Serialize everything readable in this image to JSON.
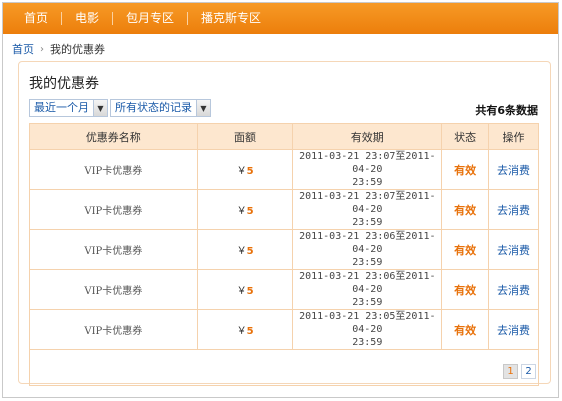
{
  "nav": {
    "items": [
      "首页",
      "电影",
      "包月专区",
      "播克斯专区"
    ]
  },
  "breadcrumb": {
    "home": "首页",
    "separator": "›",
    "current": "我的优惠券"
  },
  "panel": {
    "title": "我的优惠券",
    "filters": {
      "time": "最近一个月",
      "status": "所有状态的记录",
      "dropdown_glyph": "▼"
    },
    "count_text": "共有6条数据"
  },
  "table": {
    "headers": [
      "优惠券名称",
      "面额",
      "有效期",
      "状态",
      "操作"
    ],
    "rows": [
      {
        "name": "VIP卡优惠券",
        "yen": "￥",
        "amount": "5",
        "valid_line1": "2011-03-21 23:07至2011-04-20",
        "valid_line2": "23:59",
        "status": "有效",
        "action": "去消费"
      },
      {
        "name": "VIP卡优惠券",
        "yen": "￥",
        "amount": "5",
        "valid_line1": "2011-03-21 23:07至2011-04-20",
        "valid_line2": "23:59",
        "status": "有效",
        "action": "去消费"
      },
      {
        "name": "VIP卡优惠券",
        "yen": "￥",
        "amount": "5",
        "valid_line1": "2011-03-21 23:06至2011-04-20",
        "valid_line2": "23:59",
        "status": "有效",
        "action": "去消费"
      },
      {
        "name": "VIP卡优惠券",
        "yen": "￥",
        "amount": "5",
        "valid_line1": "2011-03-21 23:06至2011-04-20",
        "valid_line2": "23:59",
        "status": "有效",
        "action": "去消费"
      },
      {
        "name": "VIP卡优惠券",
        "yen": "￥",
        "amount": "5",
        "valid_line1": "2011-03-21 23:05至2011-04-20",
        "valid_line2": "23:59",
        "status": "有效",
        "action": "去消费"
      }
    ]
  },
  "pager": {
    "pages": [
      "1",
      "2"
    ],
    "current": "1"
  },
  "colors": {
    "nav_bg": "#f08a17",
    "accent_orange": "#e8710a",
    "link_blue": "#1a5aa8",
    "header_bg": "#fde7cf"
  }
}
